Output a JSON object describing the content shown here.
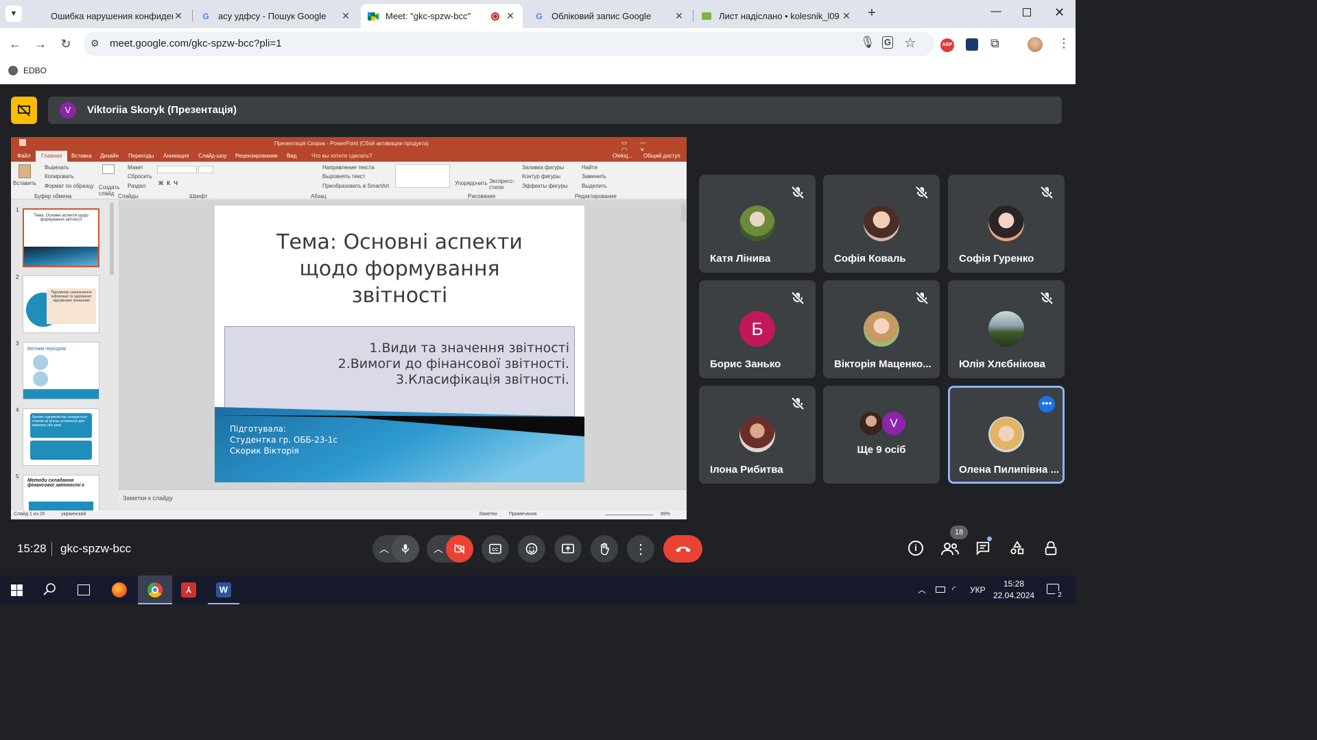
{
  "browser": {
    "tabs": [
      {
        "title": "Ошибка нарушения конфиденци",
        "icon": "error-tab-icon"
      },
      {
        "title": "асу удфсу - Пошук Google",
        "icon": "google-icon"
      },
      {
        "title": "Meet: \"gkc-spzw-bcc\"",
        "icon": "meet-icon"
      },
      {
        "title": "Обліковий запис Google",
        "icon": "google-icon"
      },
      {
        "title": "Лист надіслано • kolesnik_l09",
        "icon": "gmail-icon"
      }
    ],
    "url": "meet.google.com/gkc-spzw-bcc?pli=1",
    "bookmark": "EDBO",
    "abp_label": "ABP"
  },
  "meet": {
    "presenter_initial": "V",
    "presenter_label": "Viktoriia Skoryk (Презентація)",
    "time": "15:28",
    "meeting_code": "gkc-spzw-bcc",
    "people_count": "18",
    "participants": [
      {
        "name": "Катя Лінива",
        "initial": ""
      },
      {
        "name": "Софія Коваль",
        "initial": ""
      },
      {
        "name": "Софія Гуренко",
        "initial": ""
      },
      {
        "name": "Борис Занько",
        "initial": "Б"
      },
      {
        "name": "Вікторія Маценко...",
        "initial": ""
      },
      {
        "name": "Юлія Хлєбнікова",
        "initial": ""
      },
      {
        "name": "Ілона Рибитва",
        "initial": ""
      },
      {
        "name": "Ще 9 осіб",
        "initial": "V"
      },
      {
        "name": "Олена Пилипівна ...",
        "initial": ""
      }
    ]
  },
  "ppt": {
    "window_title": "Презентація Скорик - PowerPoint (Сбой активации продукта)",
    "user": "Oleksj...",
    "share": "Общий доступ",
    "ribbon_tabs": [
      "Файл",
      "Главная",
      "Вставка",
      "Дизайн",
      "Переходы",
      "Анимация",
      "Слайд-шоу",
      "Рецензирование",
      "Вид"
    ],
    "tell_me": "Что вы хотите сделать?",
    "clipboard": {
      "paste": "Вставить",
      "cut": "Вырезать",
      "copy": "Копировать",
      "format": "Формат по образцу",
      "group": "Буфер обмена"
    },
    "slides_group": {
      "new": "Создать слайд",
      "layout": "Макет",
      "reset": "Сбросить",
      "section": "Раздел",
      "group": "Слайды"
    },
    "font_group": "Шрифт",
    "para_group": {
      "dir": "Направление текста",
      "align": "Выровнять текст",
      "smartart": "Преобразовать в SmartArt",
      "group": "Абзац"
    },
    "drawing_group": {
      "arrange": "Упорядочить",
      "styles": "Экспресс-стили",
      "fill": "Заливка фигуры",
      "outline": "Контур фигуры",
      "effects": "Эффекты фигуры",
      "group": "Рисование"
    },
    "editing_group": {
      "find": "Найти",
      "replace": "Заменить",
      "select": "Выделить",
      "group": "Редактирование"
    },
    "slide": {
      "title_lines": [
        "Тема: Основні аспекти",
        "щодо формування",
        "звітності"
      ],
      "list": [
        "1.Види та значення звітності",
        "2.Вимоги  до фінансової звітності.",
        "3.Класифікація звітності."
      ],
      "prepared": [
        "Підготувала:",
        "Студентка гр. ОББ-23-1с",
        "Скорик Вікторія"
      ]
    },
    "thumbs": [
      {
        "num": "1",
        "text": "Тема: Основні аспекти щодо формування звітності"
      },
      {
        "num": "2",
        "text": "Підсумкове узагальнення інформації та одержання підсумкових показників"
      },
      {
        "num": "3",
        "text": "Звітним періодом"
      },
      {
        "num": "4",
        "text": "Баланс підприємства складається станом на кінець останнього дня кварталу або року"
      },
      {
        "num": "5",
        "text": "Методи складання фінансової звітності є"
      }
    ],
    "notes": "Заметки к слайду",
    "status": {
      "slide": "Слайд 1 из 20",
      "lang": "украинский",
      "notes": "Заметки",
      "comments": "Примечания",
      "zoom": "89%"
    }
  },
  "taskbar": {
    "lang": "УКР",
    "time": "15:28",
    "date": "22.04.2024",
    "notif": "2"
  }
}
